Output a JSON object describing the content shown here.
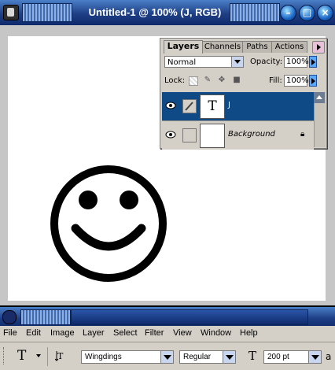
{
  "document": {
    "title": "Untitled-1 @ 100% (J, RGB)",
    "canvas_glyph": "☺"
  },
  "layers_panel": {
    "tabs": [
      "Layers",
      "Channels",
      "Paths",
      "Actions"
    ],
    "blend_mode": "Normal",
    "opacity_label": "Opacity:",
    "opacity_value": "100%",
    "lock_label": "Lock:",
    "fill_label": "Fill:",
    "fill_value": "100%",
    "layers": [
      {
        "name": "J",
        "thumb_text": "T",
        "selected": true
      },
      {
        "name": "Background",
        "thumb_text": "",
        "selected": false,
        "locked": true
      }
    ]
  },
  "menu": {
    "items": [
      "File",
      "Edit",
      "Image",
      "Layer",
      "Select",
      "Filter",
      "View",
      "Window",
      "Help"
    ]
  },
  "options_bar": {
    "tool_glyph": "T",
    "font_family": "Wingdings",
    "font_style": "Regular",
    "font_size": "200 pt",
    "trailing_glyph": "a"
  },
  "colors": {
    "title_gradient_top": "#4a7fc7",
    "title_gradient_bottom": "#0f2a6b",
    "selected_layer": "#0f4a86",
    "panel_bg": "#d4d0c8"
  }
}
